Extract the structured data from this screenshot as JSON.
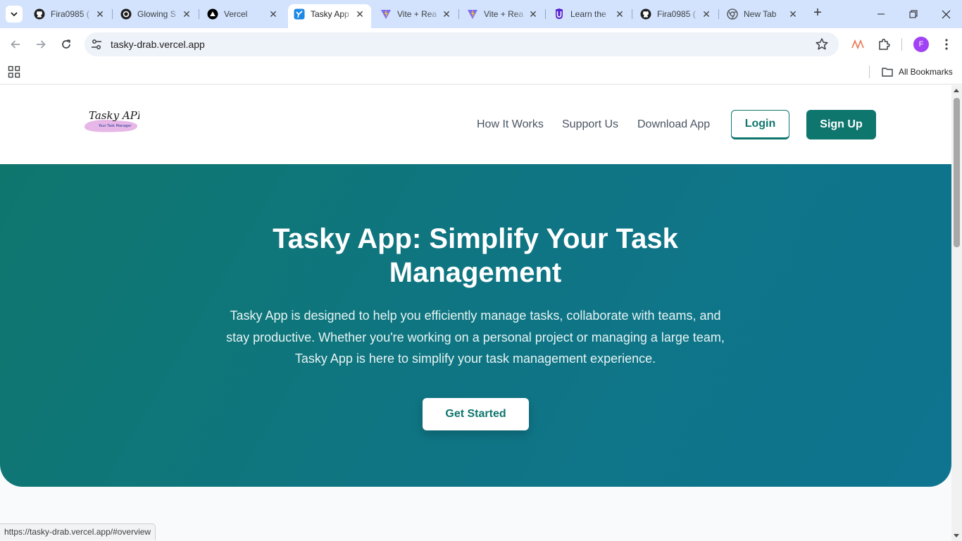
{
  "browser": {
    "tabs": [
      {
        "title": "Fira0985 (",
        "icon": "github-icon",
        "active": false
      },
      {
        "title": "Glowing S",
        "icon": "threads-icon",
        "active": false
      },
      {
        "title": "Vercel",
        "icon": "vercel-icon",
        "active": false
      },
      {
        "title": "Tasky App",
        "icon": "tasky-icon",
        "active": true
      },
      {
        "title": "Vite + Rea",
        "icon": "vite-icon",
        "active": false
      },
      {
        "title": "Vite + Rea",
        "icon": "vite-icon",
        "active": false
      },
      {
        "title": "Learn the",
        "icon": "udemy-icon",
        "active": false
      },
      {
        "title": "Fira0985 (",
        "icon": "github-icon",
        "active": false
      },
      {
        "title": "New Tab",
        "icon": "chrome-icon",
        "active": false
      }
    ],
    "address": "tasky-drab.vercel.app",
    "bookmarks_label": "All Bookmarks",
    "profile_initial": "F",
    "status_url": "https://tasky-drab.vercel.app/#overview"
  },
  "site": {
    "logo_text": "Tasky APP",
    "logo_tagline": "Your Task Manager",
    "nav": [
      "How It Works",
      "Support Us",
      "Download App"
    ],
    "login_label": "Login",
    "signup_label": "Sign Up",
    "hero": {
      "title": "Tasky App: Simplify Your Task Management",
      "description": "Tasky App is designed to help you efficiently manage tasks, collaborate with teams, and stay productive. Whether you're working on a personal project or managing a large team, Tasky App is here to simplify your task management experience.",
      "cta_label": "Get Started"
    }
  },
  "colors": {
    "brand": "#0f766e",
    "hero_gradient_end": "#0e7490",
    "tabstrip": "#d3e3fd"
  }
}
